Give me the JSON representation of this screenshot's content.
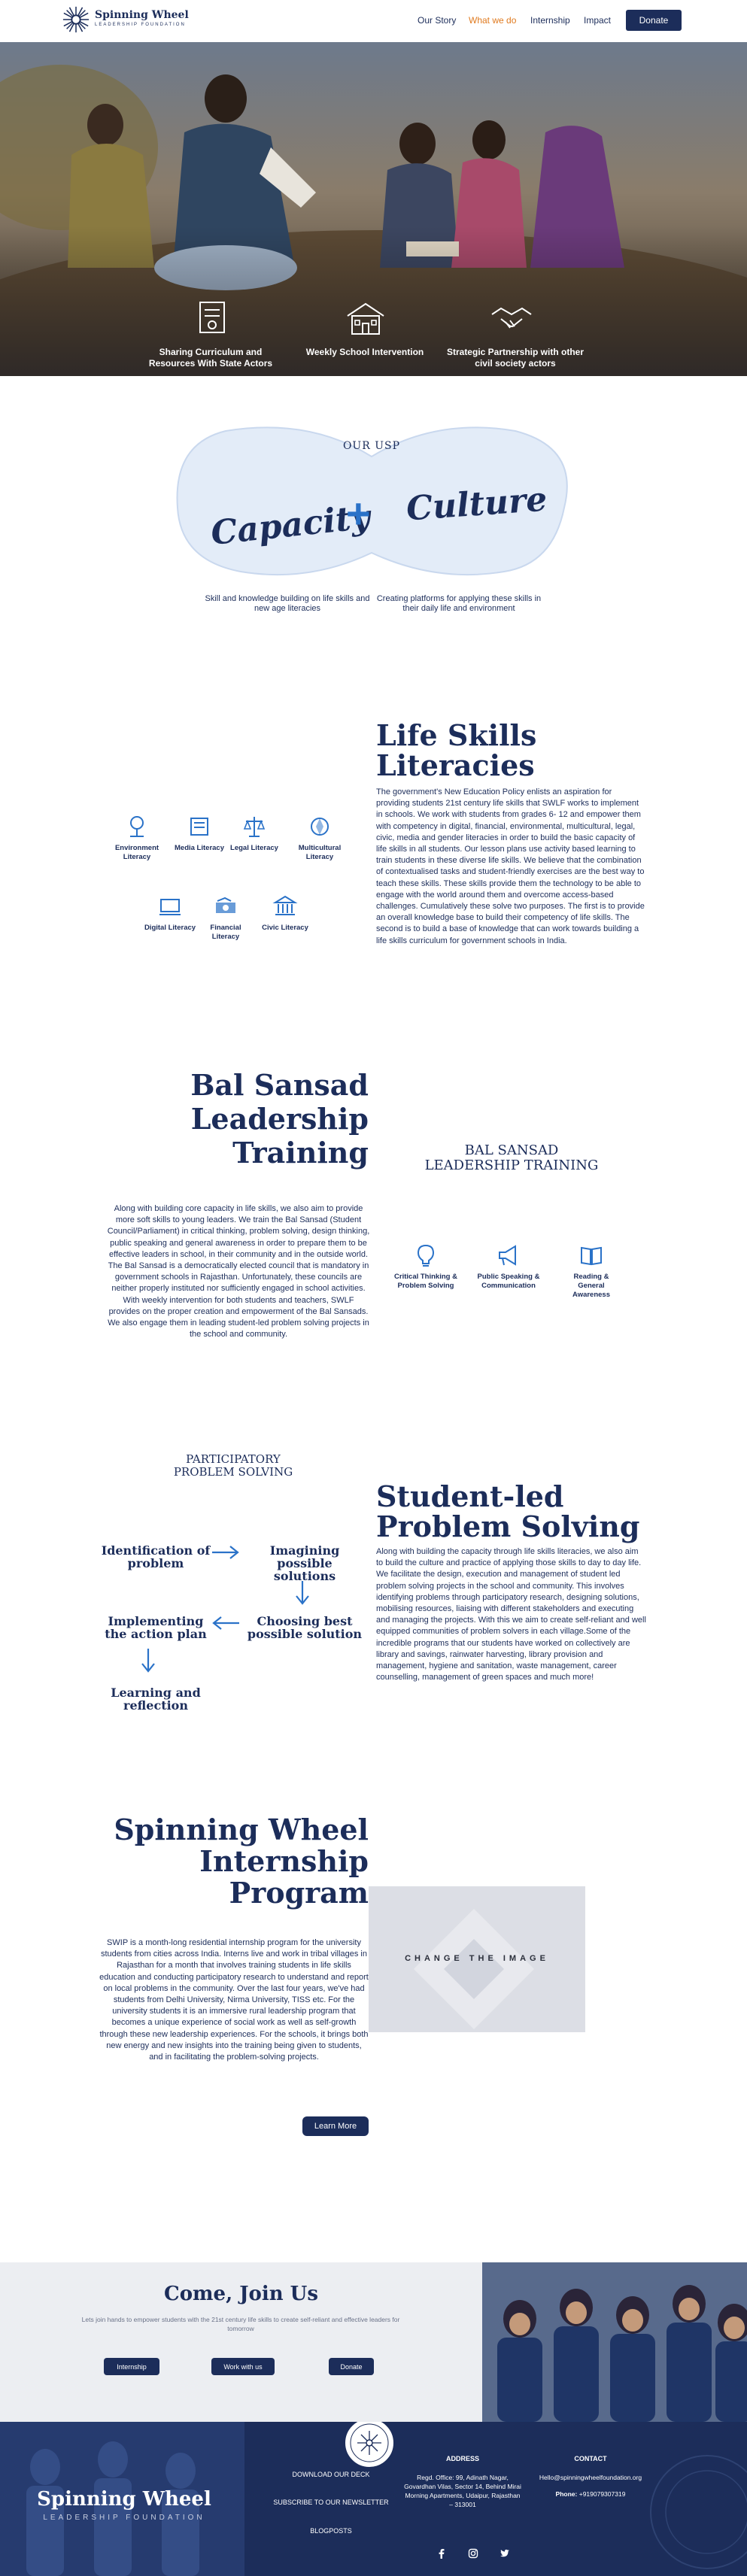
{
  "brand": {
    "name": "Spinning Wheel",
    "tagline": "LEADERSHIP FOUNDATION"
  },
  "nav": {
    "items": [
      "Our Story",
      "What we do",
      "Internship",
      "Impact"
    ],
    "active": "What we do",
    "donate": "Donate"
  },
  "hero": {
    "features": [
      {
        "icon": "certificate-icon",
        "label": "Sharing Curriculum and Resources With State Actors"
      },
      {
        "icon": "school-icon",
        "label": "Weekly School Intervention"
      },
      {
        "icon": "handshake-icon",
        "label": "Strategic Partnership with other civil society actors"
      }
    ]
  },
  "usp": {
    "title": "OUR USP",
    "left_word": "Capacity",
    "plus": "+",
    "right_word": "Culture",
    "left_caption": "Skill and knowledge building on life skills and new age literacies",
    "right_caption": "Creating platforms for applying these skills in their daily life and environment"
  },
  "life_skills": {
    "title_line1": "Life Skills",
    "title_line2": "Literacies",
    "body": "The government's New Education Policy enlists an aspiration for providing students 21st century life skills that SWLF works to implement in schools. We work with students from grades 6- 12 and empower them with competency in digital, financial, environmental, multicultural, legal, civic, media and gender literacies in order to build the basic capacity of life skills in all students. Our lesson plans use activity based learning to train students in these diverse life skills. We believe that the combination of contextualised tasks and student-friendly exercises are the best way to teach these skills. These skills provide them the technology to be able to engage with the world around them and overcome access-based challenges. Cumulatively these solve two purposes. The first is to provide an overall knowledge base to build their competency of life skills. The second is to build a base of knowledge that can work towards building a life skills curriculum for government schools in India.",
    "items": [
      {
        "icon": "environment-icon",
        "label": "Environment Literacy"
      },
      {
        "icon": "media-icon",
        "label": "Media Literacy"
      },
      {
        "icon": "legal-icon",
        "label": "Legal Literacy"
      },
      {
        "icon": "multicultural-icon",
        "label": "Multicultural Literacy"
      },
      {
        "icon": "digital-icon",
        "label": "Digital Literacy"
      },
      {
        "icon": "financial-icon",
        "label": "Financial Literacy"
      },
      {
        "icon": "civic-icon",
        "label": "Civic Literacy"
      }
    ]
  },
  "bal_sansad": {
    "title_line1": "Bal Sansad",
    "title_line2": "Leadership",
    "title_line3": "Training",
    "body": "Along with building core capacity in life skills, we also aim to provide more soft skills to young leaders. We train the Bal Sansad (Student Council/Parliament) in critical thinking, problem solving, design thinking, public speaking and general awareness in order to prepare them to be effective leaders in school, in their community and in the outside world. The Bal Sansad is a democratically elected council that is mandatory in government schools in Rajasthan. Unfortunately, these councils are neither properly instituted nor sufficiently engaged in school activities. With weekly intervention for both students and teachers, SWLF provides on the proper creation and empowerment of the Bal Sansads. We also engage them in leading student-led problem solving projects in the school and community.",
    "subtitle_line1": "BAL SANSAD",
    "subtitle_line2": "LEADERSHIP TRAINING",
    "skills": [
      {
        "icon": "bulb-icon",
        "label": "Critical Thinking & Problem Solving"
      },
      {
        "icon": "megaphone-icon",
        "label": "Public Speaking & Communication"
      },
      {
        "icon": "book-icon",
        "label": "Reading & General Awareness"
      }
    ]
  },
  "problem_solving": {
    "subtitle_line1": "PARTICIPATORY",
    "subtitle_line2": "PROBLEM SOLVING",
    "steps": [
      "Identification of problem",
      "Imagining possible solutions",
      "Choosing best possible solution",
      "Implementing the action plan",
      "Learning and reflection"
    ],
    "title_line1": "Student-led",
    "title_line2": "Problem Solving",
    "body": "Along with building the capacity through life skills literacies, we also aim to build the culture and practice of applying those skills to day to day life. We facilitate the design, execution and management of student led problem solving projects in the school and community. This involves identifying problems through participatory research, designing solutions, mobilising resources, liaising with different stakeholders and executing and managing the projects. With this we aim to create self-reliant and well equipped communities of problem solvers in each village.Some of the incredible programs that our students have worked on collectively are library and savings, rainwater harvesting, library provision and management, hygiene and sanitation, waste management, career counselling, management of green spaces and much more!"
  },
  "internship": {
    "title_line1": "Spinning Wheel",
    "title_line2": "Internship",
    "title_line3": "Program",
    "body": "SWIP is a month-long residential internship program for the university students from cities across India. Interns live and work in tribal villages in Rajasthan for a month that involves training students in life skills education and conducting participatory research to understand and report on local problems in the community. Over the last four years, we've had students from Delhi University, Nirma University, TISS etc. For the university students it is an immersive rural leadership program that becomes a unique experience of social work as well as self-growth through these new leadership experiences. For the schools, it brings both new energy and new insights into the training being given to students, and in facilitating the problem-solving projects.",
    "button": "Learn More",
    "image_label": "CHANGE THE IMAGE"
  },
  "join": {
    "title": "Come, Join Us",
    "text": "Lets join hands to empower students with the 21st century life skills to create self-reliant and effective leaders for tomorrow",
    "buttons": [
      "Internship",
      "Work with us",
      "Donate"
    ]
  },
  "footer": {
    "brand": "Spinning Wheel",
    "brand_sub": "LEADERSHIP FOUNDATION",
    "links": [
      "DOWNLOAD OUR DECK",
      "SUBSCRIBE TO OUR NEWSLETTER",
      "BLOGPOSTS"
    ],
    "address_title": "ADDRESS",
    "address": "Regd. Office: 99, Adinath Nagar, Govardhan Vilas, Sector 14, Behind Mirai Morning Apartments, Udaipur, Rajasthan – 313001",
    "contact_title": "CONTACT",
    "email": "Hello@spinningwheelfoundation.org",
    "phone_label": "Phone:",
    "phone": "+919079307319",
    "social": [
      "facebook-icon",
      "instagram-icon",
      "twitter-icon"
    ]
  }
}
